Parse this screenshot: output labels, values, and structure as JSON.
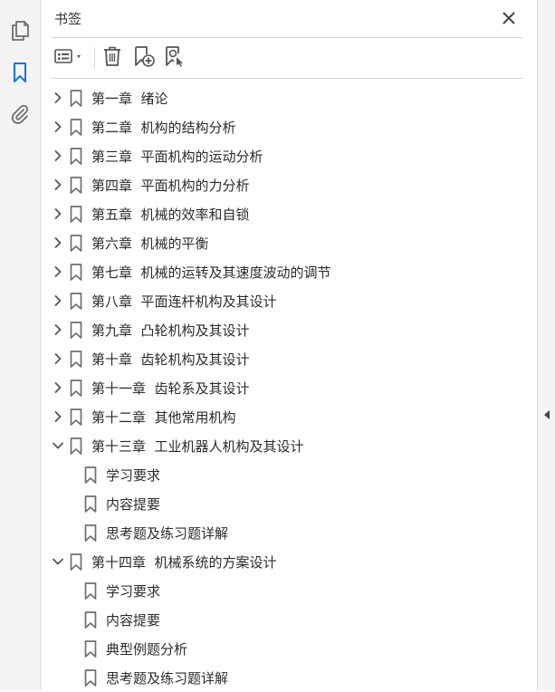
{
  "left_rail": {
    "items": [
      {
        "icon": "pages-icon",
        "active": false
      },
      {
        "icon": "bookmark-icon",
        "active": true
      },
      {
        "icon": "attachment-icon",
        "active": false
      }
    ]
  },
  "panel": {
    "title": "书签",
    "close_icon": "close-icon"
  },
  "toolbar": {
    "items": [
      {
        "icon": "options-menu-icon"
      },
      {
        "icon": "delete-icon"
      },
      {
        "icon": "new-bookmark-icon"
      },
      {
        "icon": "find-bookmark-icon"
      }
    ]
  },
  "bookmarks": [
    {
      "label": "第一章  绪论",
      "level": 0,
      "state": "collapsed"
    },
    {
      "label": "第二章  机构的结构分析",
      "level": 0,
      "state": "collapsed"
    },
    {
      "label": "第三章  平面机构的运动分析",
      "level": 0,
      "state": "collapsed"
    },
    {
      "label": "第四章  平面机构的力分析",
      "level": 0,
      "state": "collapsed"
    },
    {
      "label": "第五章  机械的效率和自锁",
      "level": 0,
      "state": "collapsed"
    },
    {
      "label": "第六章  机械的平衡",
      "level": 0,
      "state": "collapsed"
    },
    {
      "label": "第七章  机械的运转及其速度波动的调节",
      "level": 0,
      "state": "collapsed"
    },
    {
      "label": "第八章  平面连杆机构及其设计",
      "level": 0,
      "state": "collapsed"
    },
    {
      "label": "第九章  凸轮机构及其设计",
      "level": 0,
      "state": "collapsed"
    },
    {
      "label": "第十章  齿轮机构及其设计",
      "level": 0,
      "state": "collapsed"
    },
    {
      "label": "第十一章  齿轮系及其设计",
      "level": 0,
      "state": "collapsed"
    },
    {
      "label": "第十二章  其他常用机构",
      "level": 0,
      "state": "collapsed"
    },
    {
      "label": "第十三章  工业机器人机构及其设计",
      "level": 0,
      "state": "expanded"
    },
    {
      "label": "学习要求",
      "level": 1,
      "state": "leaf"
    },
    {
      "label": "内容提要",
      "level": 1,
      "state": "leaf"
    },
    {
      "label": "思考题及练习题详解",
      "level": 1,
      "state": "leaf"
    },
    {
      "label": "第十四章  机械系统的方案设计",
      "level": 0,
      "state": "expanded"
    },
    {
      "label": "学习要求",
      "level": 1,
      "state": "leaf"
    },
    {
      "label": "内容提要",
      "level": 1,
      "state": "leaf"
    },
    {
      "label": "典型例题分析",
      "level": 1,
      "state": "leaf"
    },
    {
      "label": "思考题及练习题详解",
      "level": 1,
      "state": "leaf"
    }
  ],
  "colors": {
    "accent": "#1473e6",
    "icon": "#6e6e6e",
    "text": "#2b2b2b",
    "rail_bg": "#f4f4f4"
  }
}
